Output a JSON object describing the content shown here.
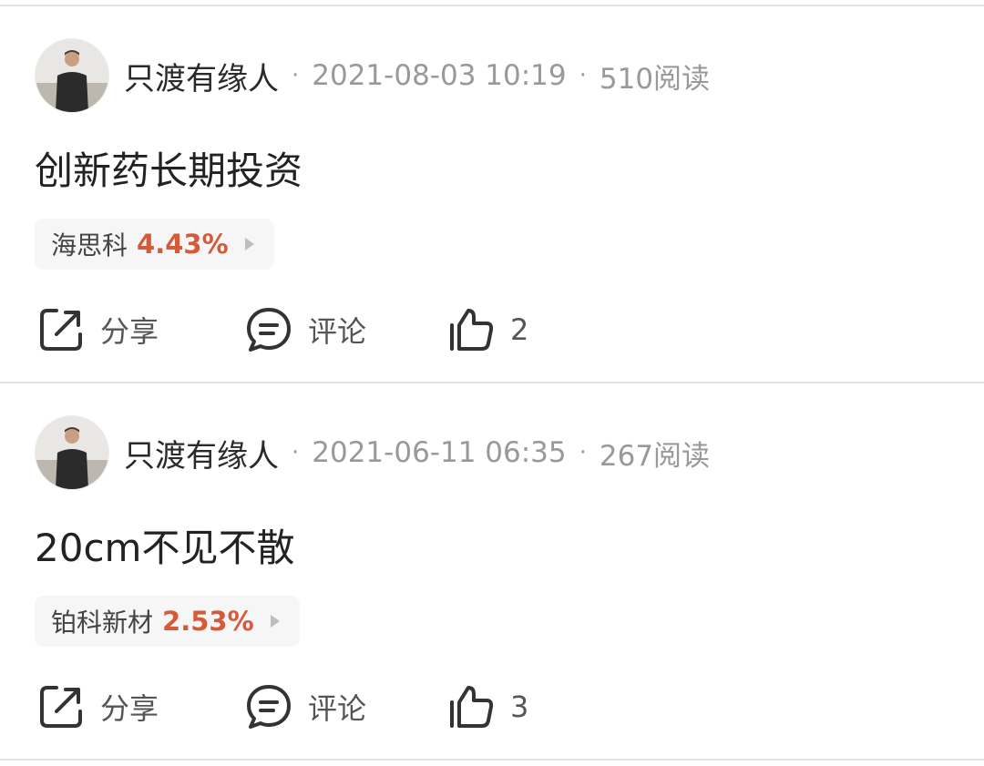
{
  "posts": [
    {
      "author": "只渡有缘人",
      "separator": "·",
      "datetime": "2021-08-03 10:19",
      "reads": "510阅读",
      "content": "创新药长期投资",
      "stock": {
        "name": "海思科",
        "change": "4.43%"
      },
      "actions": {
        "share": "分享",
        "comment": "评论",
        "likes": "2"
      }
    },
    {
      "author": "只渡有缘人",
      "separator": "·",
      "datetime": "2021-06-11 06:35",
      "reads": "267阅读",
      "content": "20cm不见不散",
      "stock": {
        "name": "铂科新材",
        "change": "2.53%"
      },
      "actions": {
        "share": "分享",
        "comment": "评论",
        "likes": "3"
      }
    }
  ],
  "colors": {
    "accent_change": "#d65a3a",
    "meta_text": "#999999",
    "divider": "#e2e2e2"
  },
  "icons": [
    "avatar-photo",
    "share-icon",
    "comment-icon",
    "like-icon",
    "chevron-right-icon"
  ]
}
